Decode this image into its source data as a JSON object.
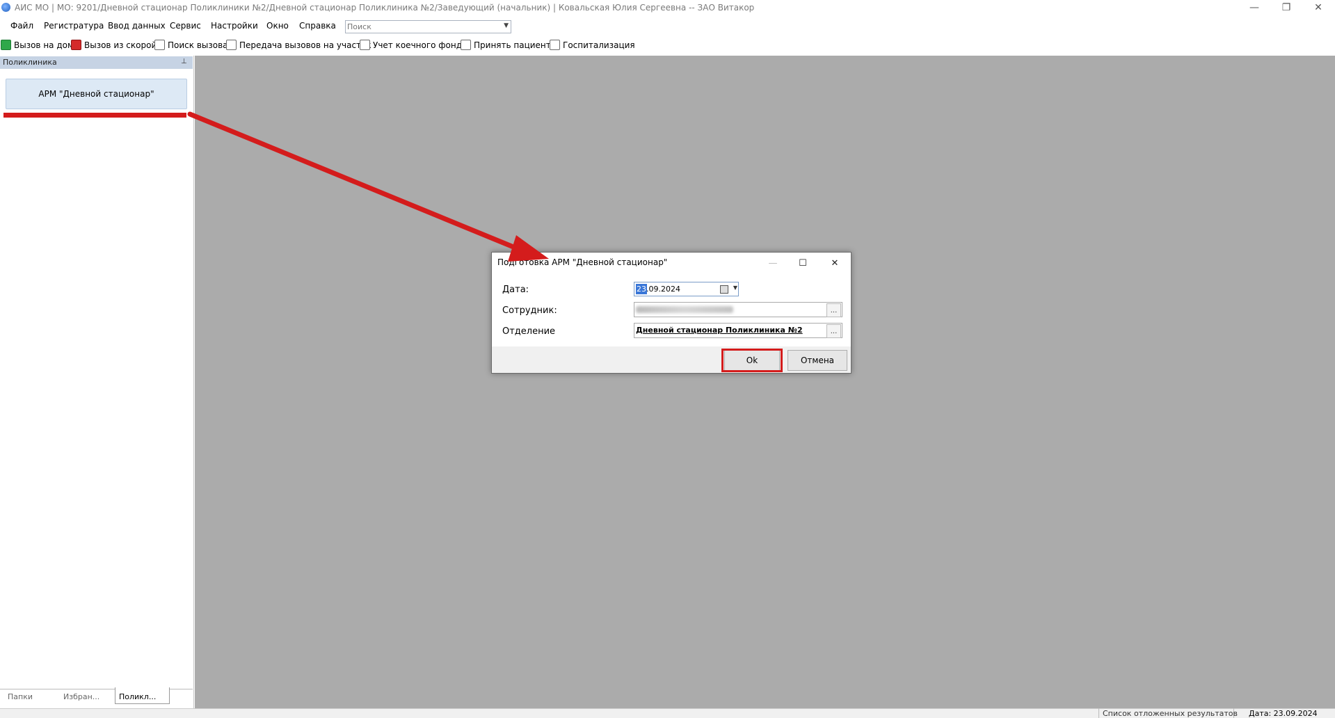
{
  "window": {
    "title": "АИС МО | МО: 9201/Дневной стационар Поликлиники №2/Дневной стационар Поликлиника №2/Заведующий (начальник) | Ковальская Юлия Сергеевна -- ЗАО Витакор",
    "controls": {
      "minimize": "—",
      "restore": "❐",
      "close": "✕"
    }
  },
  "menu": {
    "items": [
      "Файл",
      "Регистратура",
      "Ввод данных",
      "Сервис",
      "Настройки",
      "Окно",
      "Справка"
    ],
    "search_placeholder": "Поиск"
  },
  "toolbar": {
    "items": [
      {
        "label": "Вызов на дом",
        "icon": "green-check-icon"
      },
      {
        "label": "Вызов из скорой",
        "icon": "red-check-icon"
      },
      {
        "label": "Поиск вызова",
        "icon": "search-document-icon"
      },
      {
        "label": "Передача вызовов на участок",
        "icon": "transfer-icon"
      },
      {
        "label": "Учет коечного фонда",
        "icon": "bed-fund-icon"
      },
      {
        "label": "Принять пациента",
        "icon": "accept-patient-icon"
      },
      {
        "label": "Госпитализация",
        "icon": "hospitalization-icon"
      }
    ]
  },
  "left_panel": {
    "title": "Поликлиника",
    "pin": "⊥",
    "arm_button": "АРМ \"Дневной стационар\"",
    "tabs": [
      "Папки",
      "Избран...",
      "Поликл..."
    ],
    "active_tab": "Поликл..."
  },
  "dialog": {
    "title": "Подготовка АРМ \"Дневной стационар\"",
    "date_label": "Дата:",
    "date_selected": "23",
    "date_rest": ".09.2024",
    "employee_label": "Сотрудник:",
    "department_label": "Отделение",
    "department_value": "Дневной стационар Поликлиника №2",
    "lookup_button": "...",
    "ok": "Ok",
    "cancel": "Отмена",
    "controls": {
      "minimize": "—",
      "maximize": "☐",
      "close": "✕"
    }
  },
  "status_bar": {
    "pending_results": "Список отложенных результатов",
    "date": "Дата: 23.09.2024"
  },
  "annotation_color": "#d41c1c"
}
